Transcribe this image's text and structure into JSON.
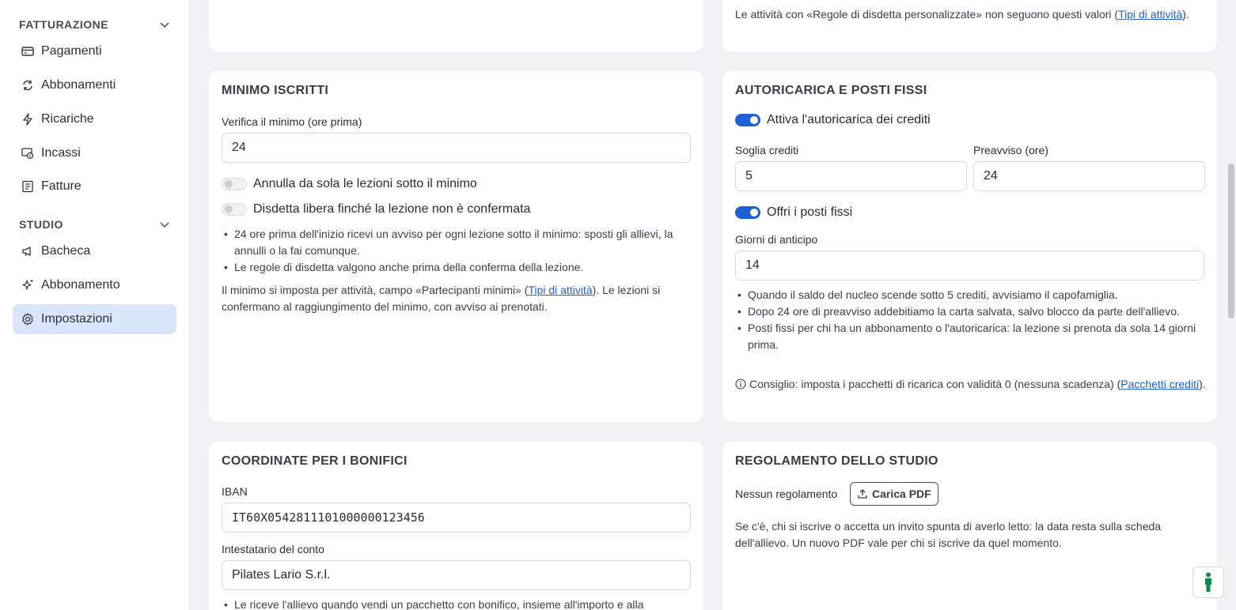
{
  "sidebar": {
    "sections": [
      {
        "title": "FATTURAZIONE",
        "items": [
          {
            "label": "Pagamenti",
            "icon": "credit-card-icon"
          },
          {
            "label": "Abbonamenti",
            "icon": "refresh-icon"
          },
          {
            "label": "Ricariche",
            "icon": "lightning-icon"
          },
          {
            "label": "Incassi",
            "icon": "cash-icon"
          },
          {
            "label": "Fatture",
            "icon": "invoice-icon"
          }
        ]
      },
      {
        "title": "STUDIO",
        "items": [
          {
            "label": "Bacheca",
            "icon": "megaphone-icon"
          },
          {
            "label": "Abbonamento",
            "icon": "sparkles-icon"
          },
          {
            "label": "Impostazioni",
            "icon": "gear-icon",
            "active": true
          }
        ]
      }
    ]
  },
  "top_left_card": {},
  "top_right_card": {
    "note_before": "Le attività con «Regole di disdetta personalizzate» non seguono questi valori (",
    "note_link": "Tipi di attività",
    "note_after": ")."
  },
  "minimo": {
    "title": "MINIMO ISCRITTI",
    "check_label": "Verifica il minimo (ore prima)",
    "check_value": "24",
    "toggle1_label": "Annulla da sola le lezioni sotto il minimo",
    "toggle1_on": false,
    "toggle2_label": "Disdetta libera finché la lezione non è confermata",
    "toggle2_on": false,
    "bullets": [
      "24 ore prima dell'inizio ricevi un avviso per ogni lezione sotto il minimo: sposti gli allievi, la annulli o la fai comunque.",
      "Le regole di disdetta valgono anche prima della conferma della lezione."
    ],
    "note_before": "Il minimo si imposta per attività, campo «Partecipanti minimi» (",
    "note_link": "Tipi di attività",
    "note_after": "). Le lezioni si confermano al raggiungimento del minimo, con avviso ai prenotati."
  },
  "autoricarica": {
    "title": "AUTORICARICA E POSTI FISSI",
    "toggle1_label": "Attiva l'autoricarica dei crediti",
    "toggle1_on": true,
    "soglia_label": "Soglia crediti",
    "soglia_value": "5",
    "preavviso_label": "Preavviso (ore)",
    "preavviso_value": "24",
    "toggle2_label": "Offri i posti fissi",
    "toggle2_on": true,
    "giorni_label": "Giorni di anticipo",
    "giorni_value": "14",
    "bullets": [
      "Quando il saldo del nucleo scende sotto 5 crediti, avvisiamo il capofamiglia.",
      "Dopo 24 ore di preavviso addebitiamo la carta salvata, salvo blocco da parte dell'allievo.",
      "Posti fissi per chi ha un abbonamento o l'autoricarica: la lezione si prenota da sola 14 giorni prima."
    ],
    "tip_before": "Consiglio: imposta i pacchetti di ricarica con validità 0 (nessuna scadenza) (",
    "tip_link": "Pacchetti crediti",
    "tip_after": ")."
  },
  "bonifici": {
    "title": "COORDINATE PER I BONIFICI",
    "iban_label": "IBAN",
    "iban_value": "IT60X0542811101000000123456",
    "intestatario_label": "Intestatario del conto",
    "intestatario_value": "Pilates Lario S.r.l.",
    "bullet": "Le riceve l'allievo quando vendi un pacchetto con bonifico, insieme all'importo e alla"
  },
  "regolamento": {
    "title": "REGOLAMENTO DELLO STUDIO",
    "status": "Nessun regolamento",
    "upload_label": "Carica PDF",
    "note": "Se c'è, chi si iscrive o accetta un invito spunta di averlo letto: la data resta sulla scheda dell'allievo. Un nuovo PDF vale per chi si iscrive da quel momento."
  },
  "colors": {
    "accent": "#1f5fd6",
    "active_nav_bg": "#d8e5fa",
    "page_bg": "#f2f2f4",
    "help_icon": "#0a8a4a"
  }
}
